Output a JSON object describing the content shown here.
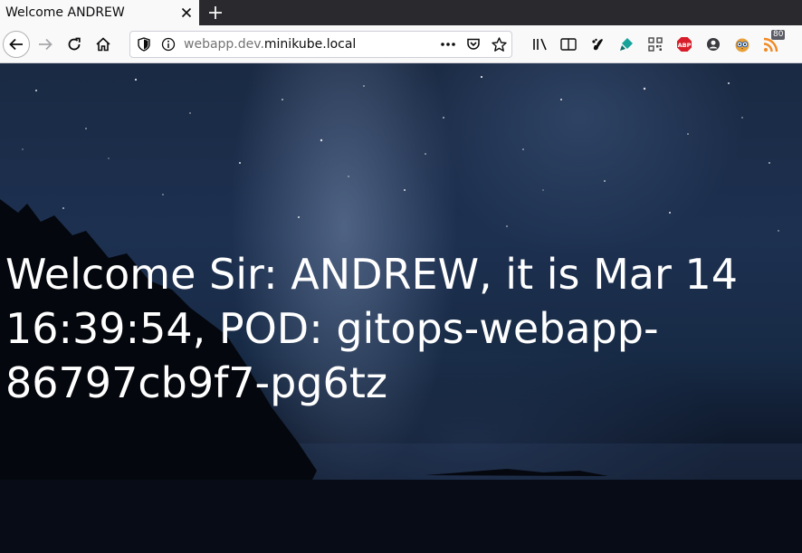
{
  "browser": {
    "tab_title": "Welcome ANDREW",
    "url_host_prefix": "webapp.dev.",
    "url_host_domain": "minikube.local",
    "rss_badge": "80"
  },
  "page": {
    "message": "Welcome Sir: ANDREW, it is Mar 14 16:39:54, POD: gitops-webapp-86797cb9f7-pg6tz"
  },
  "colors": {
    "tabstrip": "#2a2a2e",
    "toolbar": "#f9f9fa",
    "page_text": "#ffffff",
    "abp_red": "#d81d2a"
  }
}
